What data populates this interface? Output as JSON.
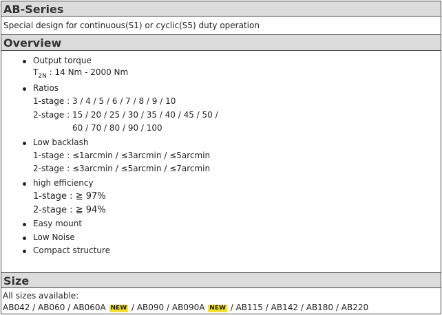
{
  "ab_series": {
    "title": "AB-Series",
    "description": "Special design for continuous(S1) or cyclic(S5) duty operation"
  },
  "overview": {
    "title": "Overview",
    "output_torque": {
      "label": "Output torque",
      "symbol": "T",
      "subscript": "2N",
      "value": ": 14 Nm - 2000 Nm"
    },
    "ratios": {
      "label": "Ratios",
      "stage1": "1-stage : 3 / 4 / 5 / 6 / 7 / 8 / 9 / 10",
      "stage2_line1": "2-stage : 15 / 20 / 25 / 30 / 35 / 40 / 45 / 50 /",
      "stage2_line2": "60 / 70 / 80 / 90 / 100"
    },
    "backlash": {
      "label": "Low backlash",
      "stage1": "1-stage : ≤1arcmin / ≤3arcmin / ≤5arcmin",
      "stage2": "2-stage : ≤3arcmin / ≤5arcmin / ≤7arcmin"
    },
    "efficiency": {
      "label": "high efficiency",
      "stage1": "1-stage : ≧ 97%",
      "stage2": "2-stage : ≧ 94%"
    },
    "easy_mount": "Easy mount",
    "low_noise": "Low Noise",
    "compact": "Compact structure"
  },
  "size": {
    "title": "Size",
    "available_label": "All sizes available:",
    "models": {
      "m1": "AB042",
      "m2": "AB060",
      "m3": "AB060A",
      "m4": "AB090",
      "m5": "AB090A",
      "m6": "AB115",
      "m7": "AB142",
      "m8": "AB180",
      "m9": "AB220"
    },
    "separator": "/",
    "new_badge": "NEW"
  }
}
